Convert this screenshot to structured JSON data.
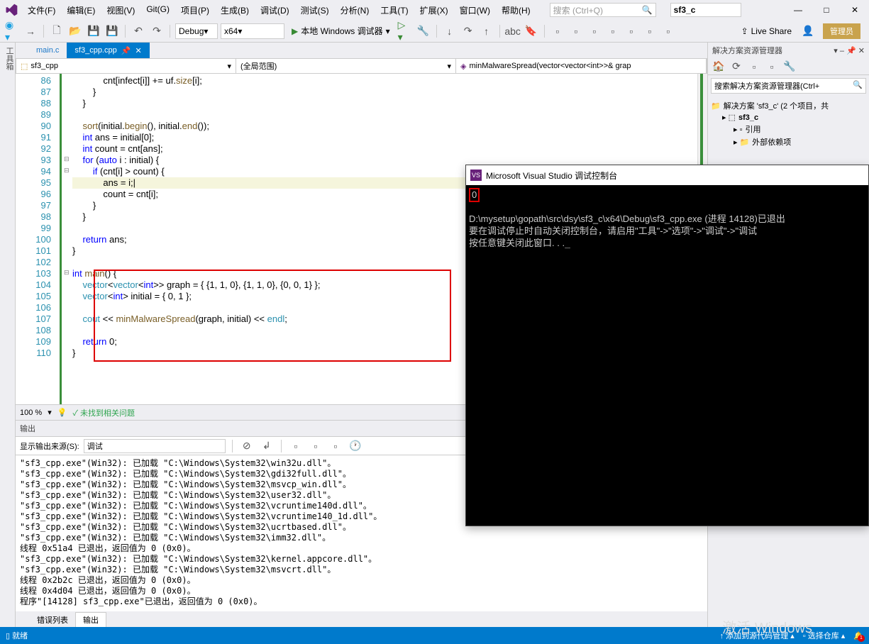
{
  "menu": {
    "file": "文件(F)",
    "edit": "编辑(E)",
    "view": "视图(V)",
    "git": "Git(G)",
    "project": "项目(P)",
    "build": "生成(B)",
    "debug": "调试(D)",
    "test": "测试(S)",
    "analyze": "分析(N)",
    "tools": "工具(T)",
    "ext": "扩展(X)",
    "window": "窗口(W)",
    "help": "帮助(H)"
  },
  "title": {
    "search_placeholder": "搜索 (Ctrl+Q)",
    "project": "sf3_c"
  },
  "window_controls": {
    "min": "—",
    "max": "□",
    "close": "✕"
  },
  "toolbar": {
    "config": "Debug",
    "platform": "x64",
    "start": "本地 Windows 调试器",
    "live_share": "Live Share",
    "admin": "管理员"
  },
  "left_tool": "工具箱",
  "tabs": {
    "inactive": "main.c",
    "active": "sf3_cpp.cpp"
  },
  "crumbs": {
    "c1": "sf3_cpp",
    "c2": "(全局范围)",
    "c3": "minMalwareSpread(vector<vector<int>>& grap"
  },
  "code": {
    "lines": [
      86,
      87,
      88,
      89,
      90,
      91,
      92,
      93,
      94,
      95,
      96,
      97,
      98,
      99,
      100,
      101,
      102,
      103,
      104,
      105,
      106,
      107,
      108,
      109,
      110
    ]
  },
  "zoom": {
    "percent": "100 %",
    "no_issues": "未找到相关问题"
  },
  "output": {
    "title": "输出",
    "source_label": "显示输出来源(S):",
    "source_value": "调试",
    "text": "\"sf3_cpp.exe\"(Win32): 已加载 \"C:\\Windows\\System32\\win32u.dll\"。\n\"sf3_cpp.exe\"(Win32): 已加载 \"C:\\Windows\\System32\\gdi32full.dll\"。\n\"sf3_cpp.exe\"(Win32): 已加载 \"C:\\Windows\\System32\\msvcp_win.dll\"。\n\"sf3_cpp.exe\"(Win32): 已加载 \"C:\\Windows\\System32\\user32.dll\"。\n\"sf3_cpp.exe\"(Win32): 已加载 \"C:\\Windows\\System32\\vcruntime140d.dll\"。\n\"sf3_cpp.exe\"(Win32): 已加载 \"C:\\Windows\\System32\\vcruntime140_1d.dll\"。\n\"sf3_cpp.exe\"(Win32): 已加载 \"C:\\Windows\\System32\\ucrtbased.dll\"。\n\"sf3_cpp.exe\"(Win32): 已加载 \"C:\\Windows\\System32\\imm32.dll\"。\n线程 0x51a4 已退出，返回值为 0 (0x0)。\n\"sf3_cpp.exe\"(Win32): 已加载 \"C:\\Windows\\System32\\kernel.appcore.dll\"。\n\"sf3_cpp.exe\"(Win32): 已加载 \"C:\\Windows\\System32\\msvcrt.dll\"。\n线程 0x2b2c 已退出，返回值为 0 (0x0)。\n线程 0x4d04 已退出，返回值为 0 (0x0)。\n程序\"[14128] sf3_cpp.exe\"已退出，返回值为 0 (0x0)。"
  },
  "bottom_tabs": {
    "err": "错误列表",
    "out": "输出"
  },
  "solution": {
    "title": "解决方案资源管理器",
    "search": "搜索解决方案资源管理器(Ctrl+",
    "root": "解决方案 'sf3_c' (2 个项目，共",
    "proj": "sf3_c",
    "ref": "引用",
    "ext": "外部依赖项"
  },
  "status": {
    "ready": "就绪",
    "add_src": "添加到源代码管理",
    "select_repo": "选择仓库"
  },
  "console": {
    "title": "Microsoft Visual Studio 调试控制台",
    "out0": "0",
    "line1": "D:\\mysetup\\gopath\\src\\dsy\\sf3_c\\x64\\Debug\\sf3_cpp.exe (进程 14128)已退出",
    "line2": "要在调试停止时自动关闭控制台，请启用\"工具\"->\"选项\"->\"调试\"->\"调试",
    "line3": "按任意键关闭此窗口. . ."
  },
  "watermark": "激活 Windows"
}
